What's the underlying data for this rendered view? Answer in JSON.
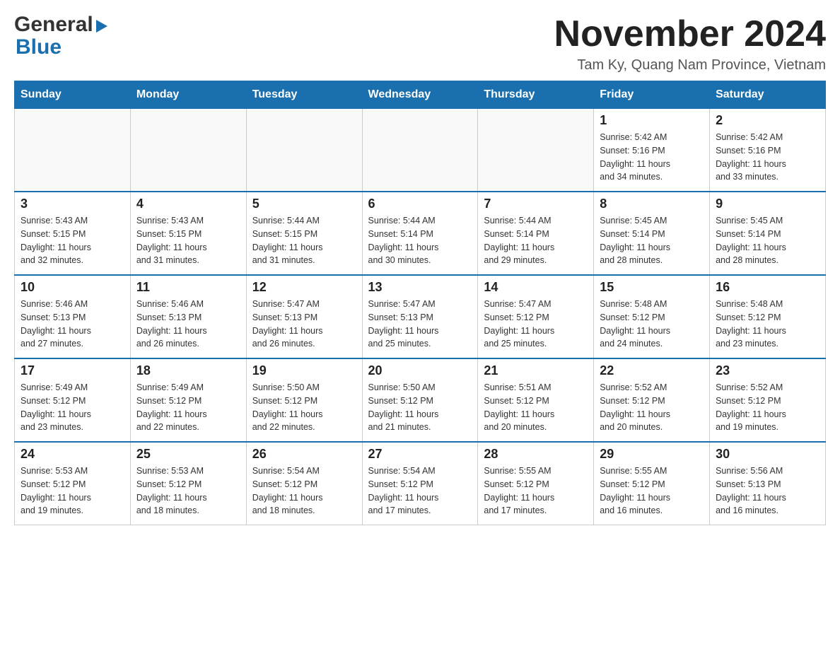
{
  "header": {
    "logo": {
      "general": "General",
      "blue": "Blue",
      "arrow_unicode": "▶"
    },
    "title": "November 2024",
    "location": "Tam Ky, Quang Nam Province, Vietnam"
  },
  "days_of_week": [
    "Sunday",
    "Monday",
    "Tuesday",
    "Wednesday",
    "Thursday",
    "Friday",
    "Saturday"
  ],
  "weeks": [
    {
      "days": [
        {
          "number": "",
          "info": ""
        },
        {
          "number": "",
          "info": ""
        },
        {
          "number": "",
          "info": ""
        },
        {
          "number": "",
          "info": ""
        },
        {
          "number": "",
          "info": ""
        },
        {
          "number": "1",
          "info": "Sunrise: 5:42 AM\nSunset: 5:16 PM\nDaylight: 11 hours\nand 34 minutes."
        },
        {
          "number": "2",
          "info": "Sunrise: 5:42 AM\nSunset: 5:16 PM\nDaylight: 11 hours\nand 33 minutes."
        }
      ]
    },
    {
      "days": [
        {
          "number": "3",
          "info": "Sunrise: 5:43 AM\nSunset: 5:15 PM\nDaylight: 11 hours\nand 32 minutes."
        },
        {
          "number": "4",
          "info": "Sunrise: 5:43 AM\nSunset: 5:15 PM\nDaylight: 11 hours\nand 31 minutes."
        },
        {
          "number": "5",
          "info": "Sunrise: 5:44 AM\nSunset: 5:15 PM\nDaylight: 11 hours\nand 31 minutes."
        },
        {
          "number": "6",
          "info": "Sunrise: 5:44 AM\nSunset: 5:14 PM\nDaylight: 11 hours\nand 30 minutes."
        },
        {
          "number": "7",
          "info": "Sunrise: 5:44 AM\nSunset: 5:14 PM\nDaylight: 11 hours\nand 29 minutes."
        },
        {
          "number": "8",
          "info": "Sunrise: 5:45 AM\nSunset: 5:14 PM\nDaylight: 11 hours\nand 28 minutes."
        },
        {
          "number": "9",
          "info": "Sunrise: 5:45 AM\nSunset: 5:14 PM\nDaylight: 11 hours\nand 28 minutes."
        }
      ]
    },
    {
      "days": [
        {
          "number": "10",
          "info": "Sunrise: 5:46 AM\nSunset: 5:13 PM\nDaylight: 11 hours\nand 27 minutes."
        },
        {
          "number": "11",
          "info": "Sunrise: 5:46 AM\nSunset: 5:13 PM\nDaylight: 11 hours\nand 26 minutes."
        },
        {
          "number": "12",
          "info": "Sunrise: 5:47 AM\nSunset: 5:13 PM\nDaylight: 11 hours\nand 26 minutes."
        },
        {
          "number": "13",
          "info": "Sunrise: 5:47 AM\nSunset: 5:13 PM\nDaylight: 11 hours\nand 25 minutes."
        },
        {
          "number": "14",
          "info": "Sunrise: 5:47 AM\nSunset: 5:12 PM\nDaylight: 11 hours\nand 25 minutes."
        },
        {
          "number": "15",
          "info": "Sunrise: 5:48 AM\nSunset: 5:12 PM\nDaylight: 11 hours\nand 24 minutes."
        },
        {
          "number": "16",
          "info": "Sunrise: 5:48 AM\nSunset: 5:12 PM\nDaylight: 11 hours\nand 23 minutes."
        }
      ]
    },
    {
      "days": [
        {
          "number": "17",
          "info": "Sunrise: 5:49 AM\nSunset: 5:12 PM\nDaylight: 11 hours\nand 23 minutes."
        },
        {
          "number": "18",
          "info": "Sunrise: 5:49 AM\nSunset: 5:12 PM\nDaylight: 11 hours\nand 22 minutes."
        },
        {
          "number": "19",
          "info": "Sunrise: 5:50 AM\nSunset: 5:12 PM\nDaylight: 11 hours\nand 22 minutes."
        },
        {
          "number": "20",
          "info": "Sunrise: 5:50 AM\nSunset: 5:12 PM\nDaylight: 11 hours\nand 21 minutes."
        },
        {
          "number": "21",
          "info": "Sunrise: 5:51 AM\nSunset: 5:12 PM\nDaylight: 11 hours\nand 20 minutes."
        },
        {
          "number": "22",
          "info": "Sunrise: 5:52 AM\nSunset: 5:12 PM\nDaylight: 11 hours\nand 20 minutes."
        },
        {
          "number": "23",
          "info": "Sunrise: 5:52 AM\nSunset: 5:12 PM\nDaylight: 11 hours\nand 19 minutes."
        }
      ]
    },
    {
      "days": [
        {
          "number": "24",
          "info": "Sunrise: 5:53 AM\nSunset: 5:12 PM\nDaylight: 11 hours\nand 19 minutes."
        },
        {
          "number": "25",
          "info": "Sunrise: 5:53 AM\nSunset: 5:12 PM\nDaylight: 11 hours\nand 18 minutes."
        },
        {
          "number": "26",
          "info": "Sunrise: 5:54 AM\nSunset: 5:12 PM\nDaylight: 11 hours\nand 18 minutes."
        },
        {
          "number": "27",
          "info": "Sunrise: 5:54 AM\nSunset: 5:12 PM\nDaylight: 11 hours\nand 17 minutes."
        },
        {
          "number": "28",
          "info": "Sunrise: 5:55 AM\nSunset: 5:12 PM\nDaylight: 11 hours\nand 17 minutes."
        },
        {
          "number": "29",
          "info": "Sunrise: 5:55 AM\nSunset: 5:12 PM\nDaylight: 11 hours\nand 16 minutes."
        },
        {
          "number": "30",
          "info": "Sunrise: 5:56 AM\nSunset: 5:13 PM\nDaylight: 11 hours\nand 16 minutes."
        }
      ]
    }
  ]
}
